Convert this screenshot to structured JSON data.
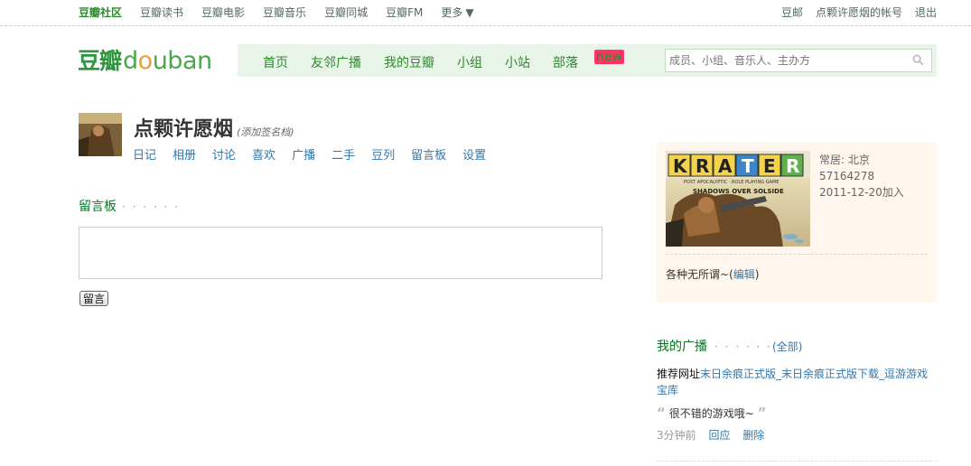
{
  "topbar": {
    "items": [
      {
        "label": "豆瓣社区",
        "active": true
      },
      {
        "label": "豆瓣读书",
        "active": false
      },
      {
        "label": "豆瓣电影",
        "active": false
      },
      {
        "label": "豆瓣音乐",
        "active": false
      },
      {
        "label": "豆瓣同城",
        "active": false
      },
      {
        "label": "豆瓣FM",
        "active": false
      },
      {
        "label": "更多",
        "active": false
      }
    ],
    "right": [
      "豆邮",
      "点颗许愿烟的帐号",
      "退出"
    ]
  },
  "logo": {
    "cn": "豆瓣",
    "en": "douban"
  },
  "mainnav": {
    "items": [
      "首页",
      "友邻广播",
      "我的豆瓣",
      "小组",
      "小站",
      "部落"
    ],
    "new_badge": "new"
  },
  "search": {
    "placeholder": "成员、小组、音乐人、主办方"
  },
  "profile": {
    "name": "点颗许愿烟",
    "signature": "(添加签名档)",
    "tabs": [
      "日记",
      "相册",
      "讨论",
      "喜欢",
      "广播",
      "二手",
      "豆列",
      "留言板",
      "设置"
    ]
  },
  "board": {
    "title": "留言板",
    "dots": "· · · · · ·",
    "post_label": "留言"
  },
  "info": {
    "location": "常居: 北京",
    "uid": "57164278",
    "joined": "2011-12-20加入",
    "intro": "各种无所谓~",
    "edit_label": "编辑",
    "image_title": "KRATER",
    "image_subtitle": "SHADOWS OVER SOLSIDE"
  },
  "broadcast": {
    "title": "我的广播",
    "dots": "· · · · · ·",
    "all_label": "全部",
    "prefix": "推荐网址",
    "link_text": "末日余痕正式版_末日余痕正式版下载_逗游游戏宝库",
    "quote": "很不错的游戏哦~",
    "time": "3分钟前",
    "reply": "回应",
    "delete": "删除"
  },
  "colors": {
    "brand_green": "#2e8a2e",
    "link_blue": "#37a",
    "nav_bg": "#e9f4e9",
    "card_bg": "#fff6ed"
  }
}
